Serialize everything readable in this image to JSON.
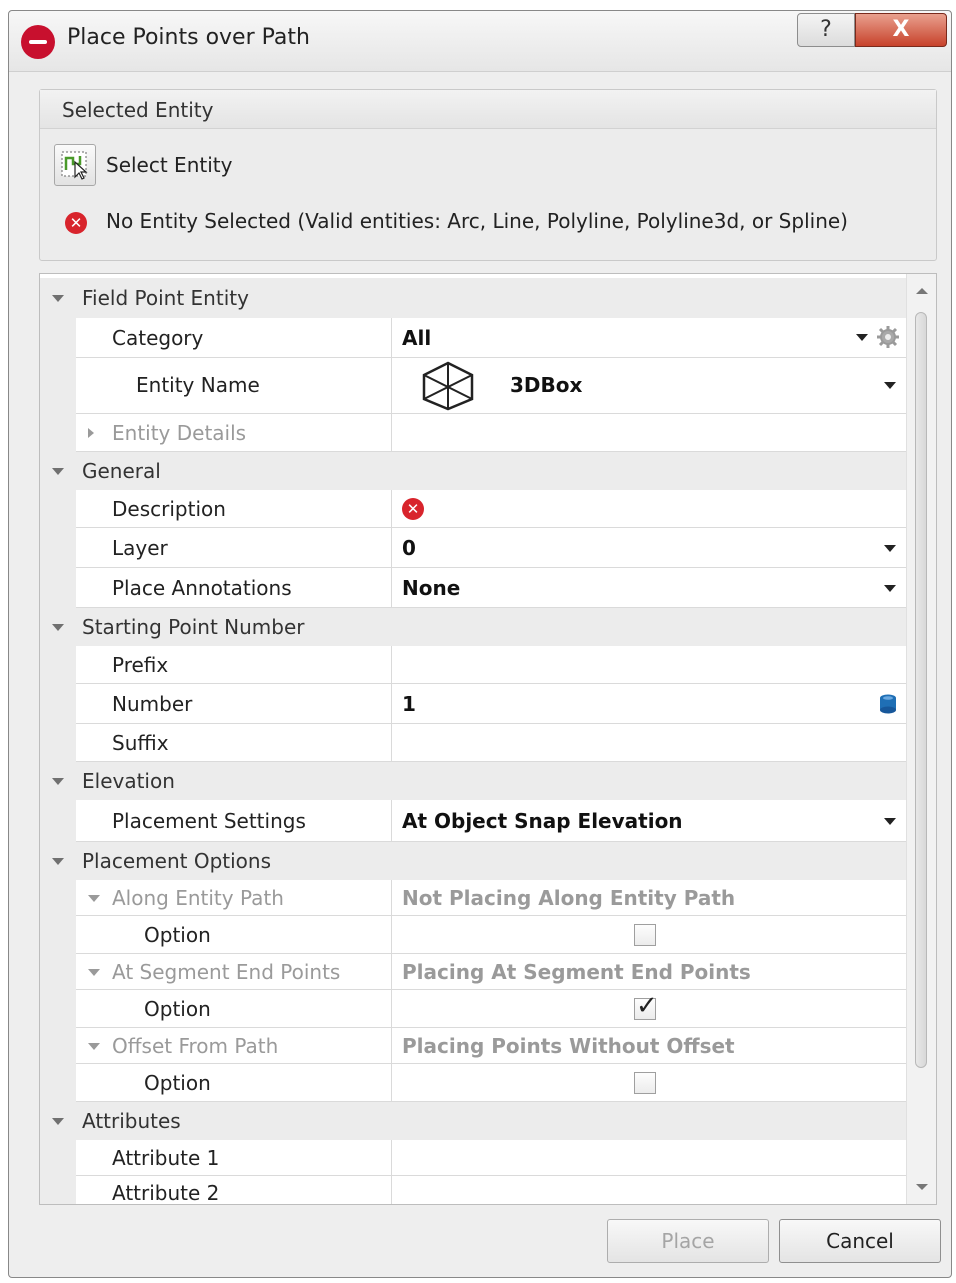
{
  "window": {
    "title": "Place Points over Path",
    "help_label": "?",
    "close_label": "X"
  },
  "selected_entity": {
    "header": "Selected Entity",
    "select_button_label": "Select Entity",
    "error_text": "No Entity Selected (Valid entities: Arc, Line, Polyline, Polyline3d, or Spline)",
    "error_icon": "error-icon"
  },
  "grid": {
    "field_point_entity": {
      "label": "Field Point Entity",
      "category": {
        "name": "Category",
        "value": "All"
      },
      "entity_name": {
        "name": "Entity Name",
        "value": "3DBox",
        "icon": "3d-box-icon"
      },
      "entity_details": {
        "name": "Entity Details"
      }
    },
    "general": {
      "label": "General",
      "description": {
        "name": "Description"
      },
      "layer": {
        "name": "Layer",
        "value": "0"
      },
      "place_annotations": {
        "name": "Place Annotations",
        "value": "None"
      }
    },
    "starting_point_number": {
      "label": "Starting Point Number",
      "prefix": {
        "name": "Prefix",
        "value": ""
      },
      "number": {
        "name": "Number",
        "value": "1"
      },
      "suffix": {
        "name": "Suffix",
        "value": ""
      }
    },
    "elevation": {
      "label": "Elevation",
      "placement_settings": {
        "name": "Placement Settings",
        "value": "At Object Snap Elevation"
      }
    },
    "placement_options": {
      "label": "Placement Options",
      "along_entity_path": {
        "name": "Along Entity Path",
        "value": "Not Placing Along Entity Path",
        "option_label": "Option",
        "checked": false
      },
      "at_segment_end_points": {
        "name": "At Segment End Points",
        "value": "Placing At Segment End Points",
        "option_label": "Option",
        "checked": true
      },
      "offset_from_path": {
        "name": "Offset From Path",
        "value": "Placing Points Without Offset",
        "option_label": "Option",
        "checked": false
      }
    },
    "attributes": {
      "label": "Attributes",
      "attribute_1": {
        "name": "Attribute 1",
        "value": ""
      },
      "attribute_2": {
        "name": "Attribute 2",
        "value": ""
      }
    }
  },
  "buttons": {
    "place": "Place",
    "cancel": "Cancel"
  },
  "colors": {
    "close": "#c7422b",
    "error": "#d8242c",
    "brand": "#c8102e",
    "number_icon": "#1f6fb5"
  }
}
